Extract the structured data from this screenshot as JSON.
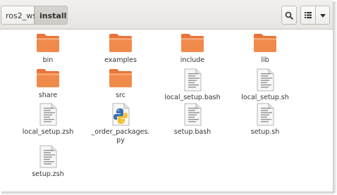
{
  "breadcrumb": {
    "parent": "ros2_ws",
    "current": "install"
  },
  "toolbar": {
    "search_icon": "search-icon",
    "view_icon": "list-view-icon",
    "menu_icon": "menu-icon"
  },
  "colors": {
    "folder_top": "#e9743a",
    "folder_body": "#f08a4b",
    "header_bg": "#e9e7e4"
  },
  "files": [
    {
      "name": "bin",
      "type": "folder"
    },
    {
      "name": "examples",
      "type": "folder"
    },
    {
      "name": "include",
      "type": "folder"
    },
    {
      "name": "lib",
      "type": "folder"
    },
    {
      "name": "share",
      "type": "folder"
    },
    {
      "name": "src",
      "type": "folder"
    },
    {
      "name": "local_setup.bash",
      "type": "script"
    },
    {
      "name": "local_setup.sh",
      "type": "script"
    },
    {
      "name": "local_setup.zsh",
      "type": "script"
    },
    {
      "name": "_order_packages.\npy",
      "type": "python"
    },
    {
      "name": "setup.bash",
      "type": "script"
    },
    {
      "name": "setup.sh",
      "type": "script"
    },
    {
      "name": "setup.zsh",
      "type": "script"
    }
  ]
}
